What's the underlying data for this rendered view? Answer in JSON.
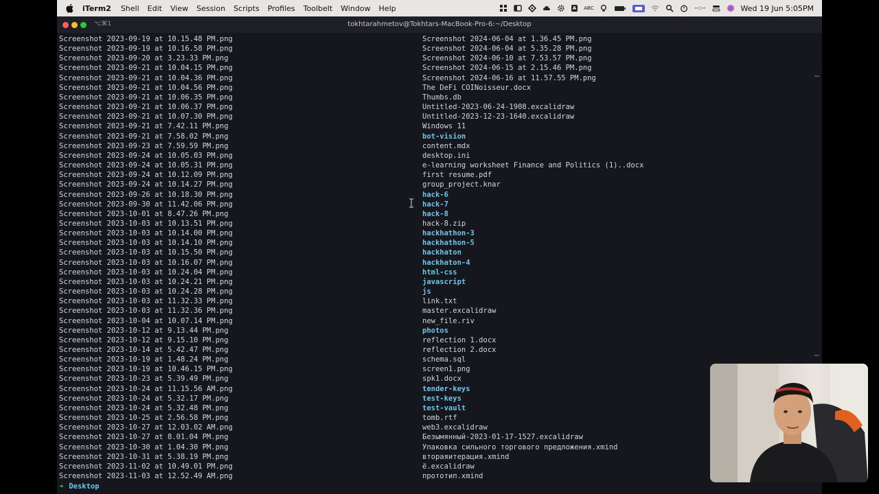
{
  "menubar": {
    "app_name": "iTerm2",
    "menus": [
      "Shell",
      "Edit",
      "View",
      "Session",
      "Scripts",
      "Profiles",
      "Toolbelt",
      "Window",
      "Help"
    ],
    "status_abc": "ABC",
    "clock": "Wed 19 Jun  5:05PM",
    "status_icons": [
      "grid-icon",
      "window-icon",
      "diamond-icon",
      "cloud-icon",
      "gear-icon",
      "input-source-icon",
      "bulb-icon",
      "battery-icon",
      "screen-share-icon",
      "wifi-icon",
      "search-icon",
      "timer-icon",
      "control-center-icon",
      "siri-icon"
    ]
  },
  "window": {
    "tab_label": "⌥⌘1",
    "title": "tokhtarahmetov@Tokhtars-MacBook-Pro-6:~/Desktop"
  },
  "terminal": {
    "colors": {
      "text": "#d5d5d8",
      "directory": "#6cc5ea",
      "prompt_arrow": "#4fd06a",
      "background": "#16171d"
    },
    "left_column": [
      "Screenshot 2023-09-19 at 10.15.48 PM.png",
      "Screenshot 2023-09-19 at 10.16.58 PM.png",
      "Screenshot 2023-09-20 at 3.23.33 PM.png",
      "Screenshot 2023-09-21 at 10.04.15 PM.png",
      "Screenshot 2023-09-21 at 10.04.36 PM.png",
      "Screenshot 2023-09-21 at 10.04.56 PM.png",
      "Screenshot 2023-09-21 at 10.06.35 PM.png",
      "Screenshot 2023-09-21 at 10.06.37 PM.png",
      "Screenshot 2023-09-21 at 10.07.30 PM.png",
      "Screenshot 2023-09-21 at 7.42.11 PM.png",
      "Screenshot 2023-09-21 at 7.58.02 PM.png",
      "Screenshot 2023-09-23 at 7.59.59 PM.png",
      "Screenshot 2023-09-24 at 10.05.03 PM.png",
      "Screenshot 2023-09-24 at 10.05.31 PM.png",
      "Screenshot 2023-09-24 at 10.12.09 PM.png",
      "Screenshot 2023-09-24 at 10.14.27 PM.png",
      "Screenshot 2023-09-26 at 10.18.30 PM.png",
      "Screenshot 2023-09-30 at 11.42.06 PM.png",
      "Screenshot 2023-10-01 at 8.47.26 PM.png",
      "Screenshot 2023-10-03 at 10.13.51 PM.png",
      "Screenshot 2023-10-03 at 10.14.00 PM.png",
      "Screenshot 2023-10-03 at 10.14.10 PM.png",
      "Screenshot 2023-10-03 at 10.15.50 PM.png",
      "Screenshot 2023-10-03 at 10.16.07 PM.png",
      "Screenshot 2023-10-03 at 10.24.04 PM.png",
      "Screenshot 2023-10-03 at 10.24.21 PM.png",
      "Screenshot 2023-10-03 at 10.24.28 PM.png",
      "Screenshot 2023-10-03 at 11.32.33 PM.png",
      "Screenshot 2023-10-03 at 11.32.36 PM.png",
      "Screenshot 2023-10-04 at 10.07.14 PM.png",
      "Screenshot 2023-10-12 at 9.13.44 PM.png",
      "Screenshot 2023-10-12 at 9.15.10 PM.png",
      "Screenshot 2023-10-14 at 5.42.47 PM.png",
      "Screenshot 2023-10-19 at 1.48.24 PM.png",
      "Screenshot 2023-10-19 at 10.46.15 PM.png",
      "Screenshot 2023-10-23 at 5.39.49 PM.png",
      "Screenshot 2023-10-24 at 11.15.56 AM.png",
      "Screenshot 2023-10-24 at 5.32.17 PM.png",
      "Screenshot 2023-10-24 at 5.32.48 PM.png",
      "Screenshot 2023-10-25 at 2.56.58 PM.png",
      "Screenshot 2023-10-27 at 12.03.02 AM.png",
      "Screenshot 2023-10-27 at 8.01.04 PM.png",
      "Screenshot 2023-10-30 at 1.04.30 PM.png",
      "Screenshot 2023-10-31 at 5.38.19 PM.png",
      "Screenshot 2023-11-02 at 10.49.01 PM.png",
      "Screenshot 2023-11-03 at 12.52.49 AM.png"
    ],
    "right_column": [
      {
        "name": "Screenshot 2024-06-04 at 1.36.45 PM.png",
        "dir": false
      },
      {
        "name": "Screenshot 2024-06-04 at 5.35.28 PM.png",
        "dir": false
      },
      {
        "name": "Screenshot 2024-06-10 at 7.53.57 PM.png",
        "dir": false
      },
      {
        "name": "Screenshot 2024-06-15 at 2.15.46 PM.png",
        "dir": false
      },
      {
        "name": "Screenshot 2024-06-16 at 11.57.55 PM.png",
        "dir": false
      },
      {
        "name": "The DeFi COINoisseur.docx",
        "dir": false
      },
      {
        "name": "Thumbs.db",
        "dir": false
      },
      {
        "name": "Untitled-2023-06-24-1908.excalidraw",
        "dir": false
      },
      {
        "name": "Untitled-2023-12-23-1640.excalidraw",
        "dir": false
      },
      {
        "name": "Windows 11",
        "dir": false
      },
      {
        "name": "bot-vision",
        "dir": true
      },
      {
        "name": "content.mdx",
        "dir": false
      },
      {
        "name": "desktop.ini",
        "dir": false
      },
      {
        "name": "e-learning worksheet Finance and Politics (1)..docx",
        "dir": false
      },
      {
        "name": "first resume.pdf",
        "dir": false
      },
      {
        "name": "group_project.knar",
        "dir": false
      },
      {
        "name": "hack-6",
        "dir": true
      },
      {
        "name": "hack-7",
        "dir": true
      },
      {
        "name": "hack-8",
        "dir": true
      },
      {
        "name": "hack-8.zip",
        "dir": false
      },
      {
        "name": "hackhathon-3",
        "dir": true
      },
      {
        "name": "hackhathon-5",
        "dir": true
      },
      {
        "name": "hackhaton",
        "dir": true
      },
      {
        "name": "hackhaton-4",
        "dir": true
      },
      {
        "name": "html-css",
        "dir": true
      },
      {
        "name": "javascript",
        "dir": true
      },
      {
        "name": "js",
        "dir": true
      },
      {
        "name": "link.txt",
        "dir": false
      },
      {
        "name": "master.excalidraw",
        "dir": false
      },
      {
        "name": "new_file.riv",
        "dir": false
      },
      {
        "name": "photos",
        "dir": true
      },
      {
        "name": "reflection 1.docx",
        "dir": false
      },
      {
        "name": "reflection 2.docx",
        "dir": false
      },
      {
        "name": "schema.sql",
        "dir": false
      },
      {
        "name": "screen1.png",
        "dir": false
      },
      {
        "name": "spk1.docx",
        "dir": false
      },
      {
        "name": "tender-keys",
        "dir": true
      },
      {
        "name": "test-keys",
        "dir": true
      },
      {
        "name": "test-vault",
        "dir": true
      },
      {
        "name": "tomb.rtf",
        "dir": false
      },
      {
        "name": "web3.excalidraw",
        "dir": false
      },
      {
        "name": "Безымянный-2023-01-17-1527.excalidraw",
        "dir": false
      },
      {
        "name": "Упаковка сильного торгового предложения.xmind",
        "dir": false
      },
      {
        "name": "втораяитерация.xmind",
        "dir": false
      },
      {
        "name": "ё.excalidraw",
        "dir": false
      },
      {
        "name": "прототип.xmind",
        "dir": false
      }
    ],
    "prompt": {
      "arrow": "➜",
      "cwd": "Desktop"
    }
  }
}
